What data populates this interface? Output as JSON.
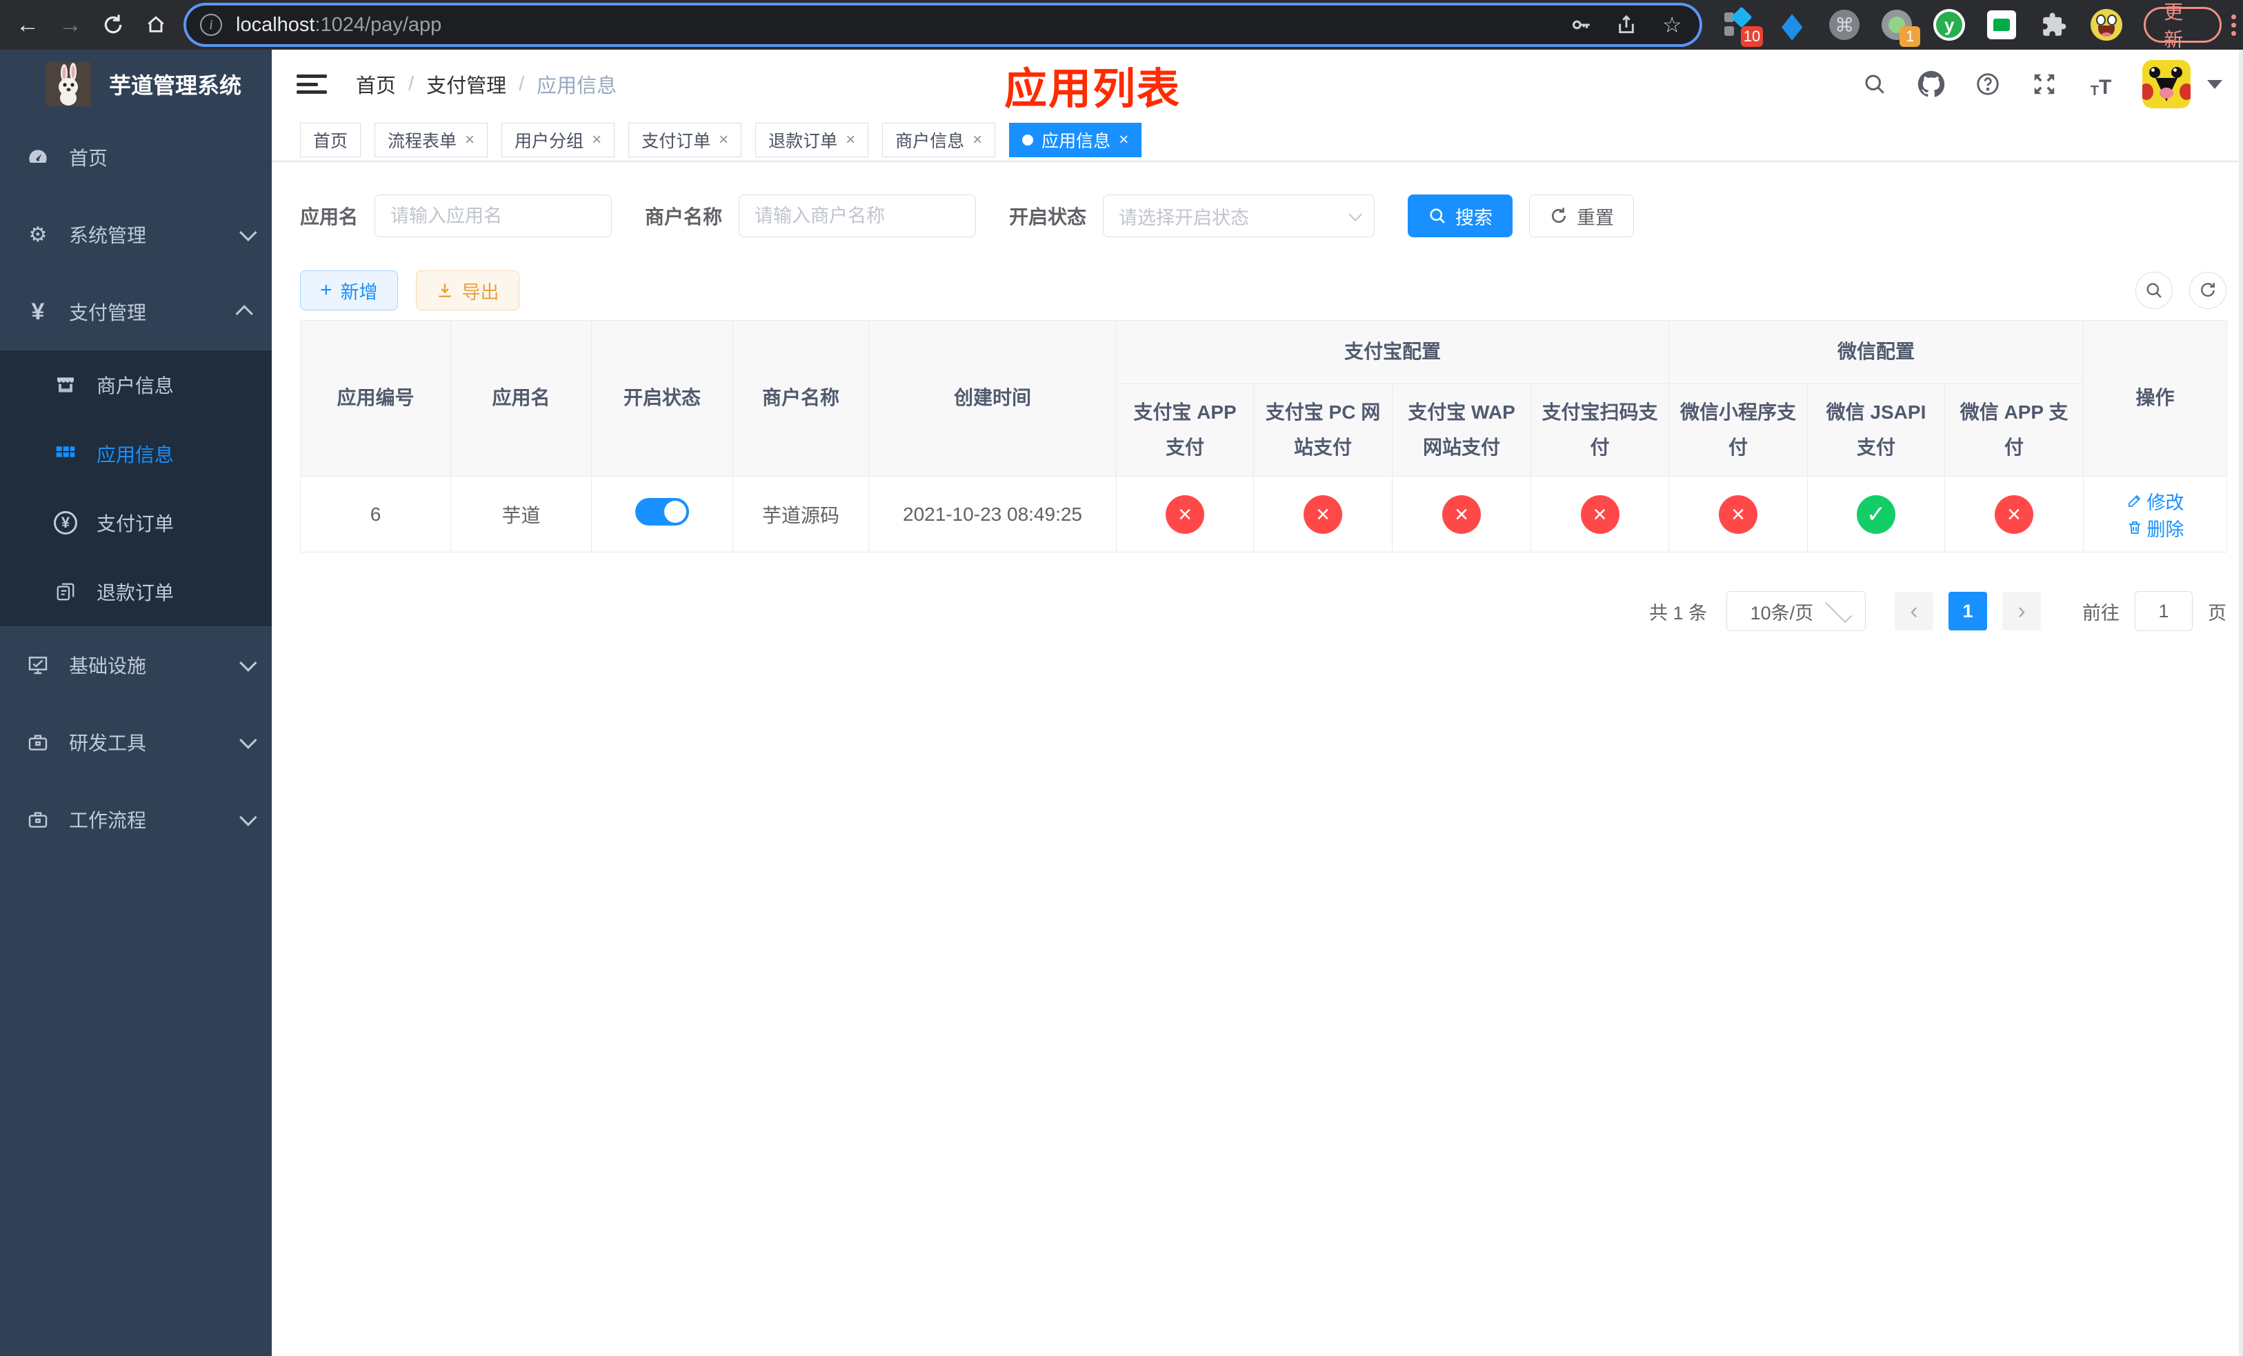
{
  "colors": {
    "primary": "#1890ff",
    "success": "#13ce66",
    "danger": "#ff4949",
    "warning": "#e6a23c",
    "sidebar_bg": "#304156",
    "submenu_bg": "#1f2d3d",
    "annotation_red": "#ff2b00"
  },
  "browser": {
    "url_host": "localhost",
    "url_path": ":1024/pay/app",
    "update_label": "更新",
    "ext_badges": {
      "axure": "10",
      "recorder": "1"
    },
    "ext_y_label": "y"
  },
  "sidebar": {
    "title": "芋道管理系统",
    "items": [
      {
        "label": "首页"
      },
      {
        "label": "系统管理",
        "chevron": "down"
      },
      {
        "label": "支付管理",
        "chevron": "up",
        "expanded": true
      },
      {
        "label": "商户信息"
      },
      {
        "label": "应用信息",
        "active": true
      },
      {
        "label": "支付订单"
      },
      {
        "label": "退款订单"
      },
      {
        "label": "基础设施",
        "chevron": "down"
      },
      {
        "label": "研发工具",
        "chevron": "down"
      },
      {
        "label": "工作流程",
        "chevron": "down"
      }
    ]
  },
  "header": {
    "breadcrumb": [
      "首页",
      "支付管理",
      "应用信息"
    ],
    "separator": "/",
    "annotation": "应用列表"
  },
  "tabs": [
    {
      "label": "首页",
      "closable": false,
      "active": false
    },
    {
      "label": "流程表单",
      "closable": true,
      "active": false
    },
    {
      "label": "用户分组",
      "closable": true,
      "active": false
    },
    {
      "label": "支付订单",
      "closable": true,
      "active": false
    },
    {
      "label": "退款订单",
      "closable": true,
      "active": false
    },
    {
      "label": "商户信息",
      "closable": true,
      "active": false
    },
    {
      "label": "应用信息",
      "closable": true,
      "active": true
    }
  ],
  "close_glyph": "×",
  "filters": {
    "app_name_label": "应用名",
    "app_name_placeholder": "请输入应用名",
    "merchant_label": "商户名称",
    "merchant_placeholder": "请输入商户名称",
    "status_label": "开启状态",
    "status_placeholder": "请选择开启状态",
    "search_label": "搜索",
    "reset_label": "重置"
  },
  "toolbar": {
    "add_label": "新增",
    "export_label": "导出"
  },
  "table": {
    "headers": {
      "app_id": "应用编号",
      "app_name": "应用名",
      "status": "开启状态",
      "merchant": "商户名称",
      "created": "创建时间",
      "group_alipay": "支付宝配置",
      "group_wechat": "微信配置",
      "ops": "操作",
      "sub": [
        "支付宝 APP 支付",
        "支付宝 PC 网站支付",
        "支付宝 WAP 网站支付",
        "支付宝扫码支付",
        "微信小程序支付",
        "微信 JSAPI 支付",
        "微信 APP 支付"
      ]
    },
    "row": {
      "app_id": "6",
      "app_name": "芋道",
      "toggle_state": "on",
      "merchant": "芋道源码",
      "created": "2021-10-23 08:49:25",
      "statuses": [
        {
          "state": "error",
          "glyph": "×"
        },
        {
          "state": "error",
          "glyph": "×"
        },
        {
          "state": "error",
          "glyph": "×"
        },
        {
          "state": "error",
          "glyph": "×"
        },
        {
          "state": "error",
          "glyph": "×"
        },
        {
          "state": "success",
          "glyph": "✓"
        },
        {
          "state": "error",
          "glyph": "×"
        }
      ],
      "edit_label": "修改",
      "delete_label": "删除"
    }
  },
  "pagination": {
    "total": "共 1 条",
    "page_size": "10条/页",
    "prev_glyph": "‹",
    "page": "1",
    "next_glyph": "›",
    "goto_label": "前往",
    "goto_value": "1",
    "goto_suffix": "页"
  }
}
